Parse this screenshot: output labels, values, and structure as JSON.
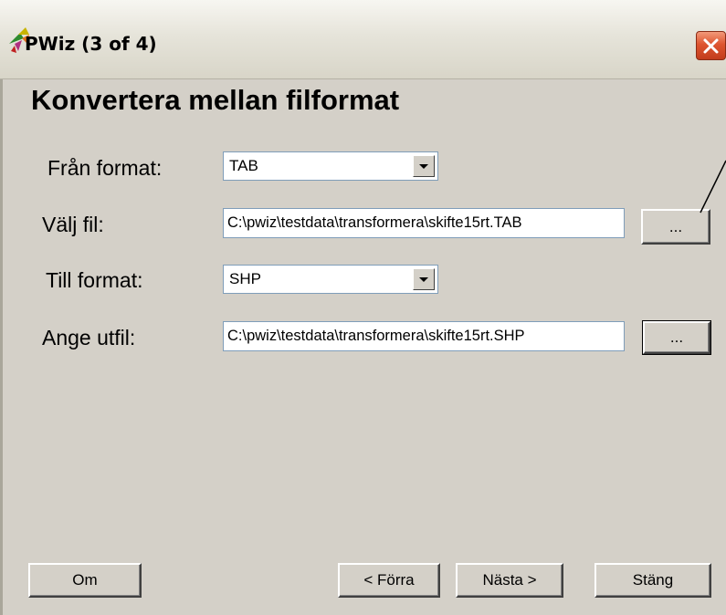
{
  "window": {
    "title": "PWiz (3 of 4)",
    "icon": "pwiz-app-icon",
    "close_icon": "close-icon"
  },
  "heading": "Konvertera mellan filformat",
  "form": {
    "from_format_label": "Från format:",
    "from_format_value": "TAB",
    "select_file_label": "Välj fil:",
    "select_file_value": "C:\\pwiz\\testdata\\transformera\\skifte15rt.TAB",
    "to_format_label": "Till format:",
    "to_format_value": "SHP",
    "output_file_label": "Ange utfil:",
    "output_file_value": "C:\\pwiz\\testdata\\transformera\\skifte15rt.SHP",
    "browse_label": "..."
  },
  "buttons": {
    "about": "Om",
    "previous": "< Förra",
    "next": "Nästa >",
    "close": "Stäng"
  }
}
